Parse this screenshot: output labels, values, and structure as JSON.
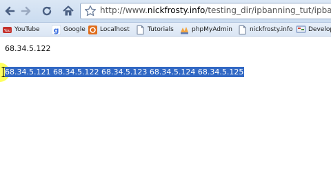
{
  "browser": {
    "url_prefix": "http://www.",
    "url_domain": "nickfrosty.info",
    "url_path": "/testing_dir/ipbanning_tut/ipbanner.p"
  },
  "bookmarks": [
    {
      "label": "YouTube",
      "icon": "youtube-icon"
    },
    {
      "label": "Google",
      "icon": "google-icon"
    },
    {
      "label": "Localhost",
      "icon": "localhost-icon"
    },
    {
      "label": "Tutorials",
      "icon": "page-icon"
    },
    {
      "label": "phpMyAdmin",
      "icon": "phpmyadmin-icon"
    },
    {
      "label": "nickfrosty.info",
      "icon": "page-icon"
    },
    {
      "label": "Develop",
      "icon": "develop-icon"
    }
  ],
  "page": {
    "current_ip": "68.34.5.122",
    "ip_list": "68.34.5.121 68.34.5.122 68.34.5.123 68.34.5.124 68.34.5.125"
  },
  "colors": {
    "selection": "#3168c4",
    "toolbar": "#cbdcf0"
  }
}
